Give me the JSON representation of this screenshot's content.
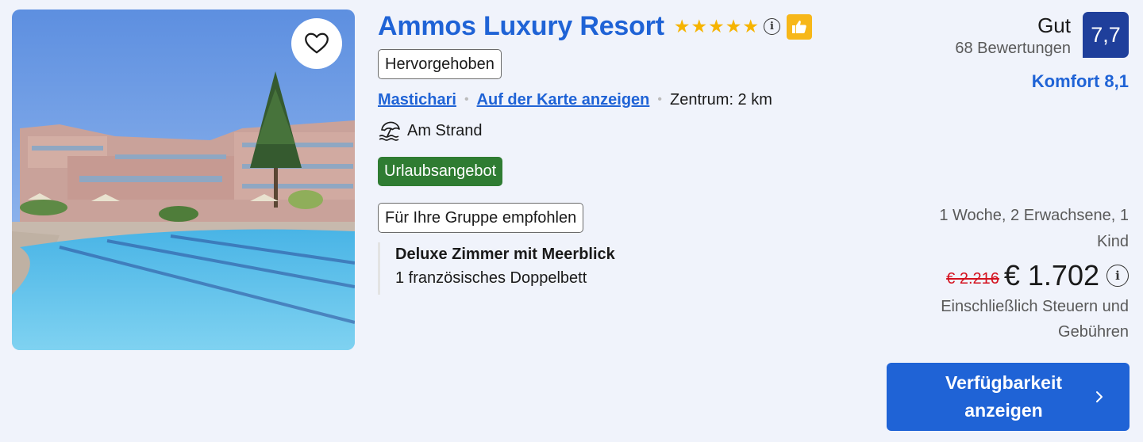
{
  "hotel": {
    "name": "Ammos Luxury Resort",
    "star_count": 5,
    "star_color": "#f6b400",
    "info_glyph": "i",
    "featured_label": "Hervorgehoben",
    "location_link": "Mastichari",
    "map_link": "Auf der Karte anzeigen",
    "distance": "Zentrum: 2 km",
    "beach_icon": "beach-umbrella-icon",
    "beach_label": "Am Strand",
    "deal_label": "Urlaubsangebot",
    "deal_color": "#2f7c32",
    "group_label": "Für Ihre Gruppe empfohlen",
    "room_name": "Deluxe Zimmer mit Meerblick",
    "bed_info": "1 französisches Doppelbett"
  },
  "review": {
    "word": "Gut",
    "count": "68 Bewertungen",
    "score": "7,7",
    "score_color": "#1f3f9b",
    "comfort": "Komfort 8,1"
  },
  "price": {
    "stay_line1": "1 Woche, 2 Erwachsene, 1",
    "stay_line2": "Kind",
    "old_price": "€ 2.216",
    "new_price": "€ 1.702",
    "info_glyph": "i",
    "tax_line1": "Einschließlich Steuern und",
    "tax_line2": "Gebühren"
  },
  "cta": {
    "line1": "Verfügbarkeit",
    "line2": "anzeigen",
    "color": "#1f63d6"
  },
  "accent": "#1f63d6"
}
